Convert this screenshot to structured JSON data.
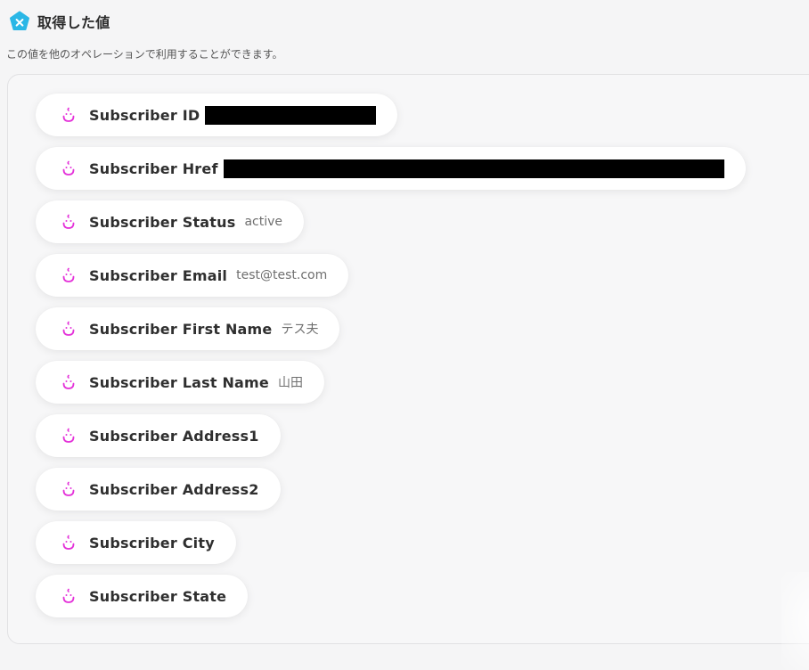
{
  "header": {
    "title": "取得した値",
    "icon": "x-variable-icon",
    "icon_color": "#2ab7e6"
  },
  "subtitle": "この値を他のオペレーションで利用することができます。",
  "item_icon": "subscriber-face-icon",
  "accent_color": "#e432d9",
  "items": [
    {
      "label": "Subscriber ID",
      "value": "",
      "redacted": true
    },
    {
      "label": "Subscriber Href",
      "value": "",
      "redacted": true
    },
    {
      "label": "Subscriber Status",
      "value": "active"
    },
    {
      "label": "Subscriber Email",
      "value": "test@test.com"
    },
    {
      "label": "Subscriber First Name",
      "value": "テス夫"
    },
    {
      "label": "Subscriber Last Name",
      "value": "山田"
    },
    {
      "label": "Subscriber Address1",
      "value": ""
    },
    {
      "label": "Subscriber Address2",
      "value": ""
    },
    {
      "label": "Subscriber City",
      "value": ""
    },
    {
      "label": "Subscriber State",
      "value": ""
    }
  ]
}
